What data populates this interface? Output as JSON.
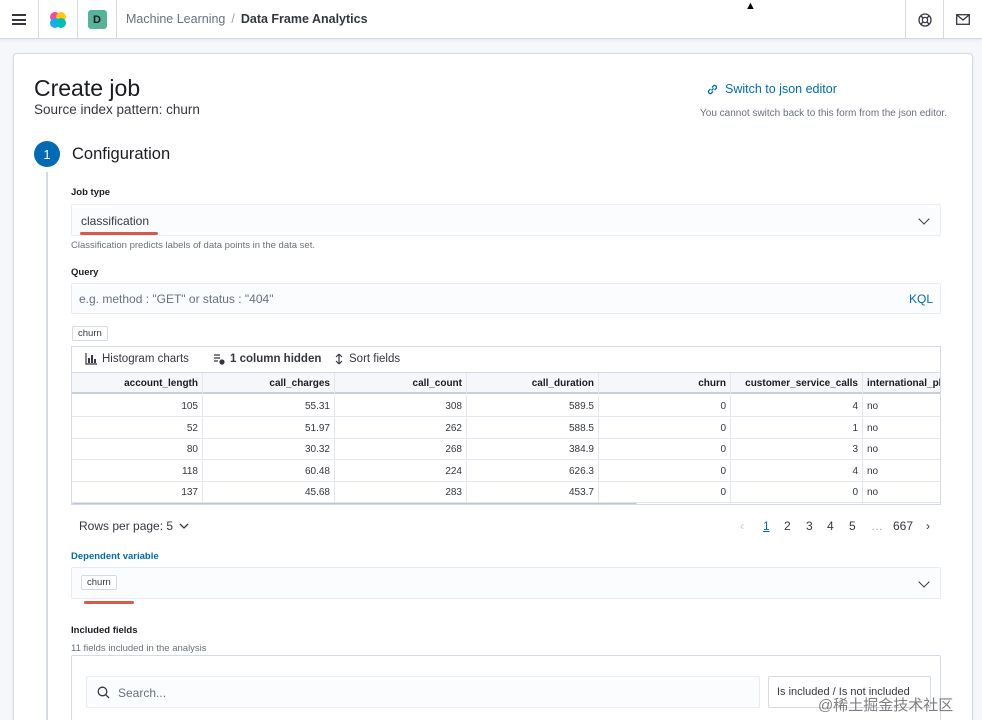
{
  "header": {
    "space_initial": "D",
    "breadcrumb_1": "Machine Learning",
    "breadcrumb_sep": "/",
    "breadcrumb_2": "Data Frame Analytics"
  },
  "page": {
    "title": "Create job",
    "subtitle": "Source index pattern: churn",
    "json_link": "Switch to json editor",
    "json_note": "You cannot switch back to this form from the json editor."
  },
  "step": {
    "number": "1",
    "title": "Configuration"
  },
  "job_type": {
    "label": "Job type",
    "value": "classification",
    "help": "Classification predicts labels of data points in the data set."
  },
  "query": {
    "label": "Query",
    "placeholder": "e.g. method : \"GET\" or status : \"404\"",
    "kql": "KQL"
  },
  "index_badge": "churn",
  "grid": {
    "toolbar": {
      "histogram": "Histogram charts",
      "hidden": "1 column hidden",
      "sort": "Sort fields"
    },
    "columns": [
      "account_length",
      "call_charges",
      "call_count",
      "call_duration",
      "churn",
      "customer_service_calls",
      "international_pl"
    ],
    "rows": [
      [
        "105",
        "55.31",
        "308",
        "589.5",
        "0",
        "4",
        "no"
      ],
      [
        "52",
        "51.97",
        "262",
        "588.5",
        "0",
        "1",
        "no"
      ],
      [
        "80",
        "30.32",
        "268",
        "384.9",
        "0",
        "3",
        "no"
      ],
      [
        "118",
        "60.48",
        "224",
        "626.3",
        "0",
        "4",
        "no"
      ],
      [
        "137",
        "45.68",
        "283",
        "453.7",
        "0",
        "0",
        "no"
      ]
    ]
  },
  "pagination": {
    "rows_per_page": "Rows per page: 5",
    "pages": [
      "1",
      "2",
      "3",
      "4",
      "5",
      "…",
      "667"
    ]
  },
  "dependent_variable": {
    "label": "Dependent variable",
    "value": "churn"
  },
  "included_fields": {
    "label": "Included fields",
    "help": "11 fields included in the analysis",
    "search_placeholder": "Search...",
    "filter_label": "Is included / Is not included"
  },
  "watermark": "@稀土掘金技术社区",
  "colors": {
    "accent": "#006bb4",
    "space_badge": "#54b399",
    "underline": "#d65a4a"
  }
}
